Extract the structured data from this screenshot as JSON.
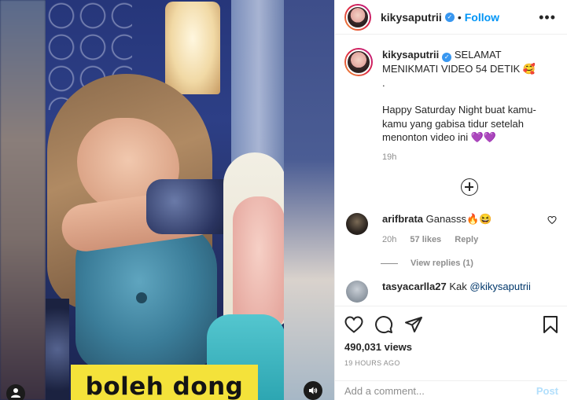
{
  "post": {
    "username": "kikysaputrii",
    "follow_label": "Follow",
    "separator": "•",
    "more_label": "•••",
    "caption_line1": "SELAMAT MENIKMATI VIDEO 54 DETIK 🥰",
    "caption_dot": ".",
    "caption_line2": "Happy Saturday Night buat kamu-kamu yang gabisa tidur setelah menonton video ini 💜💜",
    "caption_time": "19h"
  },
  "video": {
    "overlay_caption": "boleh dong"
  },
  "comments": [
    {
      "username": "arifbrata",
      "text": "Ganasss🔥😆",
      "time": "20h",
      "likes": "57 likes",
      "reply_label": "Reply",
      "view_replies": "View replies (1)"
    },
    {
      "username": "tasyacarlla27",
      "text": "Kak",
      "mention": "@kikysaputrii"
    }
  ],
  "stats": {
    "views": "490,031 views",
    "posted": "19 HOURS AGO"
  },
  "composer": {
    "placeholder": "Add a comment...",
    "post_label": "Post"
  },
  "icons": {
    "verified": "verified-badge-icon",
    "like": "heart-icon",
    "comment": "comment-icon",
    "share": "paper-plane-icon",
    "save": "bookmark-icon",
    "add": "plus-circle-icon"
  },
  "colors": {
    "accent": "#0095f6",
    "verified": "#3897f0",
    "caption_bg": "#f4e23a"
  }
}
